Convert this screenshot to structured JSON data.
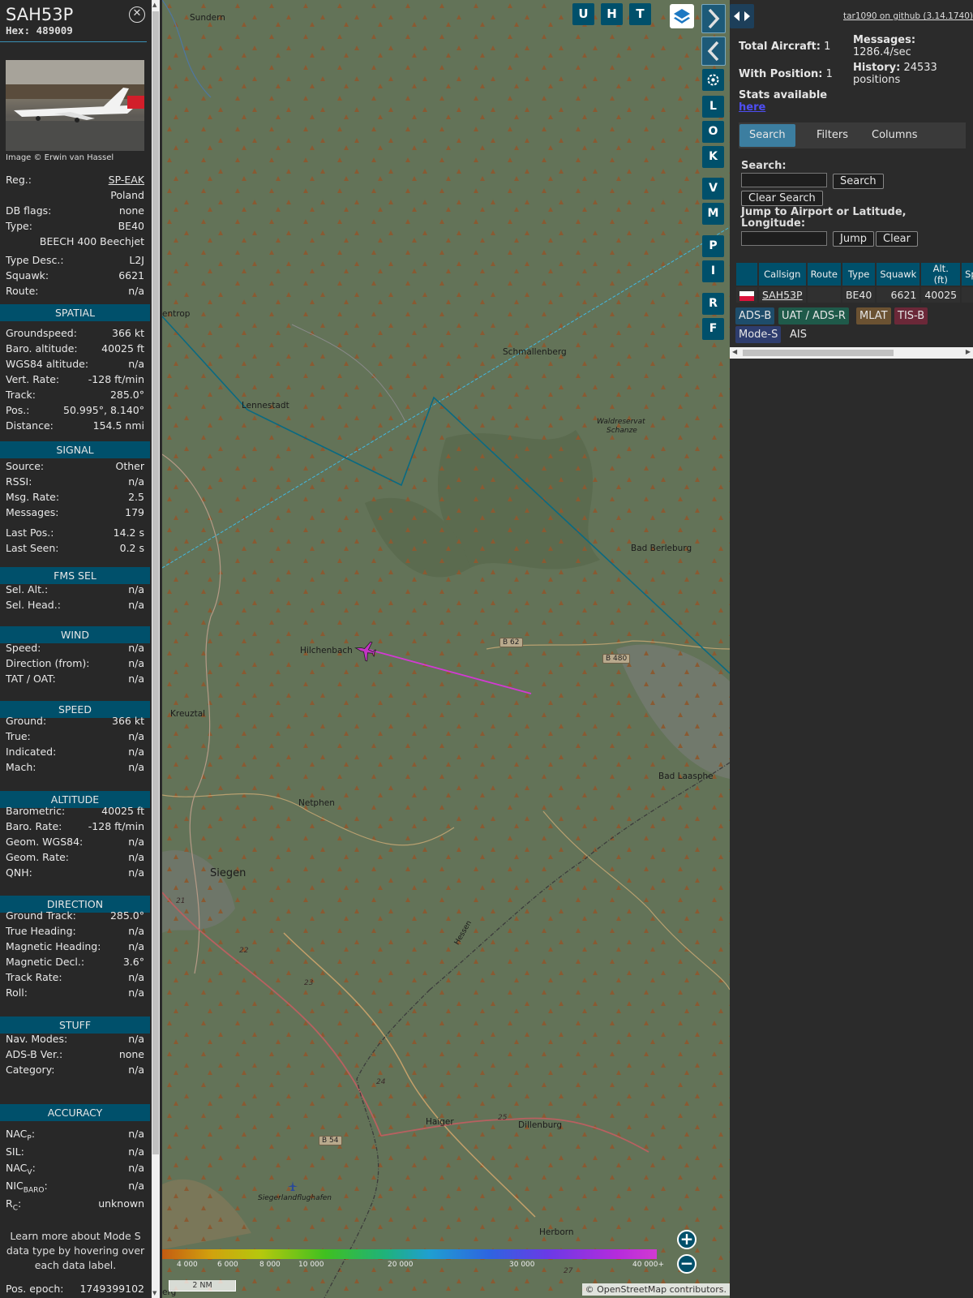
{
  "sidebar": {
    "callsign": "SAH53P",
    "hex_label": "Hex:",
    "hex": "489009",
    "close_icon": "close-icon",
    "photo_credit": "Image © Erwin van Hassel",
    "reg_label": "Reg.:",
    "reg": "SP-EAK",
    "country": "Poland",
    "dbflags_label": "DB flags:",
    "dbflags": "none",
    "type_label": "Type:",
    "type": "BE40",
    "type_full": "BEECH 400 Beechjet",
    "typedesc_label": "Type Desc.:",
    "typedesc": "L2J",
    "squawk_label": "Squawk:",
    "squawk": "6621",
    "route_label": "Route:",
    "route": "n/a",
    "sections": {
      "spatial": "SPATIAL",
      "signal": "SIGNAL",
      "fms": "FMS SEL",
      "wind": "WIND",
      "speed": "SPEED",
      "altitude": "ALTITUDE",
      "direction": "DIRECTION",
      "stuff": "STUFF",
      "accuracy": "ACCURACY"
    },
    "spatial": [
      [
        "Groundspeed:",
        "366 kt"
      ],
      [
        "Baro. altitude:",
        "40025 ft"
      ],
      [
        "WGS84 altitude:",
        "n/a"
      ],
      [
        "Vert. Rate:",
        "-128 ft/min"
      ],
      [
        "Track:",
        "285.0°"
      ],
      [
        "Pos.:",
        "50.995°, 8.140°"
      ],
      [
        "Distance:",
        "154.5 nmi"
      ]
    ],
    "signal": [
      [
        "Source:",
        "Other"
      ],
      [
        "RSSI:",
        "n/a"
      ],
      [
        "Msg. Rate:",
        "2.5"
      ],
      [
        "Messages:",
        "179"
      ],
      [
        "Last Pos.:",
        "14.2 s"
      ],
      [
        "Last Seen:",
        "0.2 s"
      ]
    ],
    "fms": [
      [
        "Sel. Alt.:",
        "n/a"
      ],
      [
        "Sel. Head.:",
        "n/a"
      ]
    ],
    "wind": [
      [
        "Speed:",
        "n/a"
      ],
      [
        "Direction (from):",
        "n/a"
      ],
      [
        "TAT / OAT:",
        "n/a"
      ]
    ],
    "speed": [
      [
        "Ground:",
        "366 kt"
      ],
      [
        "True:",
        "n/a"
      ],
      [
        "Indicated:",
        "n/a"
      ],
      [
        "Mach:",
        "n/a"
      ]
    ],
    "altitude": [
      [
        "Barometric:",
        "40025 ft"
      ],
      [
        "Baro. Rate:",
        "-128 ft/min"
      ],
      [
        "Geom. WGS84:",
        "n/a"
      ],
      [
        "Geom. Rate:",
        "n/a"
      ],
      [
        "QNH:",
        "n/a"
      ]
    ],
    "direction": [
      [
        "Ground Track:",
        "285.0°"
      ],
      [
        "True Heading:",
        "n/a"
      ],
      [
        "Magnetic Heading:",
        "n/a"
      ],
      [
        "Magnetic Decl.:",
        "3.6°"
      ],
      [
        "Track Rate:",
        "n/a"
      ],
      [
        "Roll:",
        "n/a"
      ]
    ],
    "stuff": [
      [
        "Nav. Modes:",
        "n/a"
      ],
      [
        "ADS-B Ver.:",
        "none"
      ],
      [
        "Category:",
        "n/a"
      ]
    ],
    "accuracy": [
      [
        "NAC",
        "P",
        ":",
        "n/a"
      ],
      [
        "SIL:",
        "",
        "",
        "n/a"
      ],
      [
        "NAC",
        "V",
        ":",
        "n/a"
      ],
      [
        "NIC",
        "BARO",
        ":",
        "n/a"
      ],
      [
        "R",
        "C",
        ":",
        "unknown"
      ]
    ],
    "learn_more": "Learn more about Mode S data type by hovering over each data label.",
    "epoch_label": "Pos. epoch:",
    "epoch": "1749399102"
  },
  "map": {
    "towns": [
      "Sundern",
      "entrop",
      "Schmallenberg",
      "Lennestadt",
      "Waldreservat",
      "Schanze",
      "Bad Berleburg",
      "Hilchenbach",
      "Kreuztal",
      "Bad Laasphe",
      "Netphen",
      "Siegen",
      "Haiger",
      "Dillenburg",
      "Herborn",
      "Siegerlandflughafen",
      "Hessen",
      "erg"
    ],
    "roads": [
      "B 62",
      "B 480",
      "B 54"
    ],
    "road_numbers": [
      "21",
      "22",
      "23",
      "24",
      "25",
      "27"
    ],
    "toolbar": [
      "U",
      "H",
      "T"
    ],
    "side_buttons": [
      "L",
      "O",
      "K",
      "V",
      "M",
      "P",
      "I",
      "R",
      "F"
    ],
    "altitude_labels": [
      "4 000",
      "6 000",
      "8 000",
      "10 000",
      "20 000",
      "30 000",
      "40 000+"
    ],
    "scale": "2 NM",
    "attribution_prefix": "© ",
    "attribution_link": "OpenStreetMap",
    "attribution_suffix": " contributors.",
    "icons": [
      "layers-icon",
      "chevron-right-icon",
      "chevron-left-icon",
      "gear-icon",
      "expand-icon",
      "zoom-in-icon",
      "zoom-out-icon",
      "aircraft-icon"
    ]
  },
  "right": {
    "github": "tar1090 on github (3.14.1740)",
    "total_label": "Total Aircraft:",
    "total": "1",
    "withpos_label": "With Position:",
    "withpos": "1",
    "messages_label": "Messages:",
    "messages": "1286.4/sec",
    "history_label": "History:",
    "history": "24533 positions",
    "stats_text": "Stats available",
    "stats_link": "here",
    "tabs": [
      "Search",
      "Filters",
      "Columns"
    ],
    "search_label": "Search:",
    "search_btn": "Search",
    "clear_search_btn": "Clear Search",
    "jump_label": "Jump to Airport or Latitude, Longitude:",
    "jump_btn": "Jump",
    "clear_btn": "Clear",
    "columns": [
      "Callsign",
      "Route",
      "Type",
      "Squawk",
      "Alt. (ft)",
      "Spd."
    ],
    "rows": [
      {
        "callsign": "SAH53P",
        "route": "",
        "type": "BE40",
        "squawk": "6621",
        "alt": "40025",
        "spd": ""
      }
    ],
    "sources": [
      {
        "label": "ADS-B",
        "color": "#1e4d6b"
      },
      {
        "label": "UAT / ADS-R",
        "color": "#1f5a4a"
      },
      {
        "label": "MLAT",
        "color": "#6b5232"
      },
      {
        "label": "TIS-B",
        "color": "#6b2838"
      },
      {
        "label": "Mode-S",
        "color": "#2e3d6e"
      },
      {
        "label": "AIS",
        "color": "#2b2b2b"
      }
    ]
  },
  "colors": {
    "accent": "#00506b",
    "track_color": "#cc33cc",
    "map_base": "#637358"
  }
}
